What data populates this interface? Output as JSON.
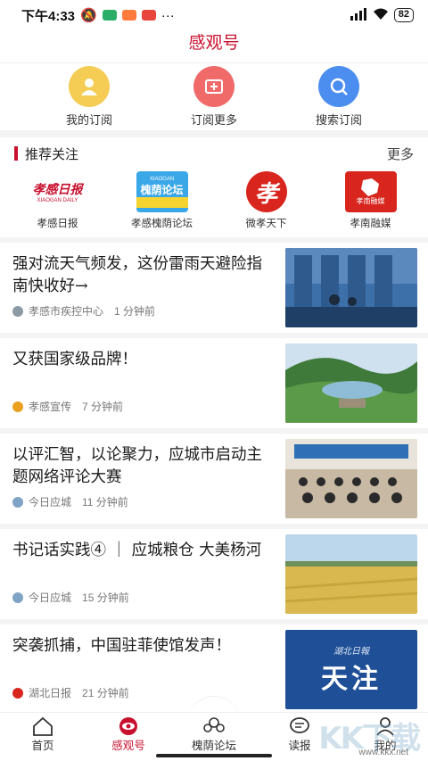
{
  "status": {
    "time": "下午4:33",
    "battery": "82"
  },
  "header": {
    "title": "感观号"
  },
  "quick_actions": [
    {
      "label": "我的订阅",
      "color": "#f5cd55",
      "icon": "user-icon"
    },
    {
      "label": "订阅更多",
      "color": "#f06a6a",
      "icon": "add-subscribe-icon"
    },
    {
      "label": "搜索订阅",
      "color": "#4b8ef0",
      "icon": "search-icon"
    }
  ],
  "recommend": {
    "title": "推荐关注",
    "more": "更多"
  },
  "follows": [
    {
      "label": "孝感日报",
      "logo_text": "孝感日报",
      "logo_sub": "XIAOGAN DAILY"
    },
    {
      "label": "孝感槐荫论坛",
      "logo_text": "槐荫论坛",
      "logo_sub": "XIAOGAN"
    },
    {
      "label": "微孝天下",
      "logo_text": "孝"
    },
    {
      "label": "孝南融媒",
      "logo_text": "孝南融媒"
    }
  ],
  "news": [
    {
      "title": "强对流天气频发，这份雷雨天避险指南快收好→",
      "source": "孝感市疾控中心",
      "time": "1 分钟前",
      "thumb": "rain"
    },
    {
      "title": "又获国家级品牌！",
      "source": "孝感宣传",
      "time": "7 分钟前",
      "thumb": "lake"
    },
    {
      "title": "以评汇智，以论聚力，应城市启动主题网络评论大赛",
      "source": "今日应城",
      "time": "11 分钟前",
      "thumb": "meeting"
    },
    {
      "title": "书记话实践④ ｜ 应城粮仓  大美杨河",
      "source": "今日应城",
      "time": "15 分钟前",
      "thumb": "field"
    },
    {
      "title": "突袭抓捕，中国驻菲使馆发声！",
      "source": "湖北日报",
      "time": "21 分钟前",
      "thumb": "attention",
      "thumb_title": "天注",
      "thumb_sub": "湖北日報"
    }
  ],
  "nav": [
    {
      "label": "首页",
      "icon": "home-icon",
      "active": false
    },
    {
      "label": "感观号",
      "icon": "eye-icon",
      "active": true
    },
    {
      "label": "槐荫论坛",
      "icon": "forum-icon",
      "active": false
    },
    {
      "label": "读报",
      "icon": "newspaper-icon",
      "active": false
    },
    {
      "label": "我的",
      "icon": "profile-icon",
      "active": false
    }
  ],
  "watermark": {
    "text": "KK下载",
    "url": "www.kkx.net"
  }
}
